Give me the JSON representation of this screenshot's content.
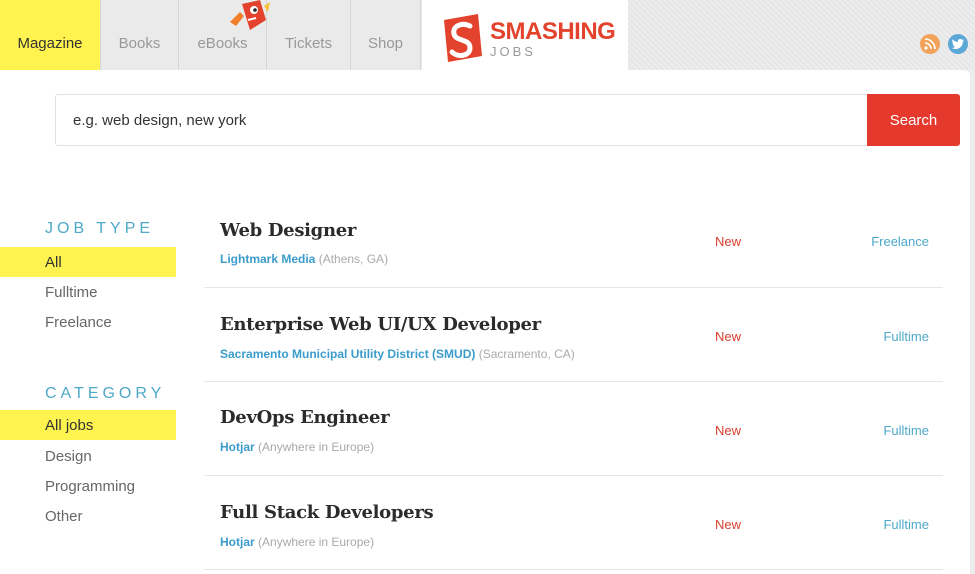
{
  "nav": {
    "tabs": [
      {
        "label": "Magazine",
        "active": true
      },
      {
        "label": "Books",
        "active": false
      },
      {
        "label": "eBooks",
        "active": false
      },
      {
        "label": "Tickets",
        "active": false
      },
      {
        "label": "Shop",
        "active": false
      }
    ],
    "logo_word": "SMASHING",
    "logo_sub": "JOBS",
    "social_icons": [
      "rss-icon",
      "twitter-icon"
    ]
  },
  "search": {
    "placeholder": "e.g. web design, new york",
    "button_label": "Search"
  },
  "sidebar": {
    "job_type_heading": "JOB TYPE",
    "job_types": [
      {
        "label": "All",
        "active": true
      },
      {
        "label": "Fulltime",
        "active": false
      },
      {
        "label": "Freelance",
        "active": false
      }
    ],
    "category_heading": "CATEGORY",
    "categories": [
      {
        "label": "All jobs",
        "active": true
      },
      {
        "label": "Design",
        "active": false
      },
      {
        "label": "Programming",
        "active": false
      },
      {
        "label": "Other",
        "active": false
      }
    ]
  },
  "jobs": [
    {
      "title": "Web Designer",
      "company": "Lightmark Media",
      "location": "(Athens, GA)",
      "badge": "New",
      "type": "Freelance"
    },
    {
      "title": "Enterprise Web UI/UX Developer",
      "company": "Sacramento Municipal Utility District (SMUD)",
      "location": "(Sacramento, CA)",
      "badge": "New",
      "type": "Fulltime"
    },
    {
      "title": "DevOps Engineer",
      "company": "Hotjar",
      "location": "(Anywhere in Europe)",
      "badge": "New",
      "type": "Fulltime"
    },
    {
      "title": "Full Stack Developers",
      "company": "Hotjar",
      "location": "(Anywhere in Europe)",
      "badge": "New",
      "type": "Fulltime"
    }
  ],
  "colors": {
    "highlight": "#fff44f",
    "accent_red": "#e4392c",
    "link_blue": "#3b9ccc"
  }
}
